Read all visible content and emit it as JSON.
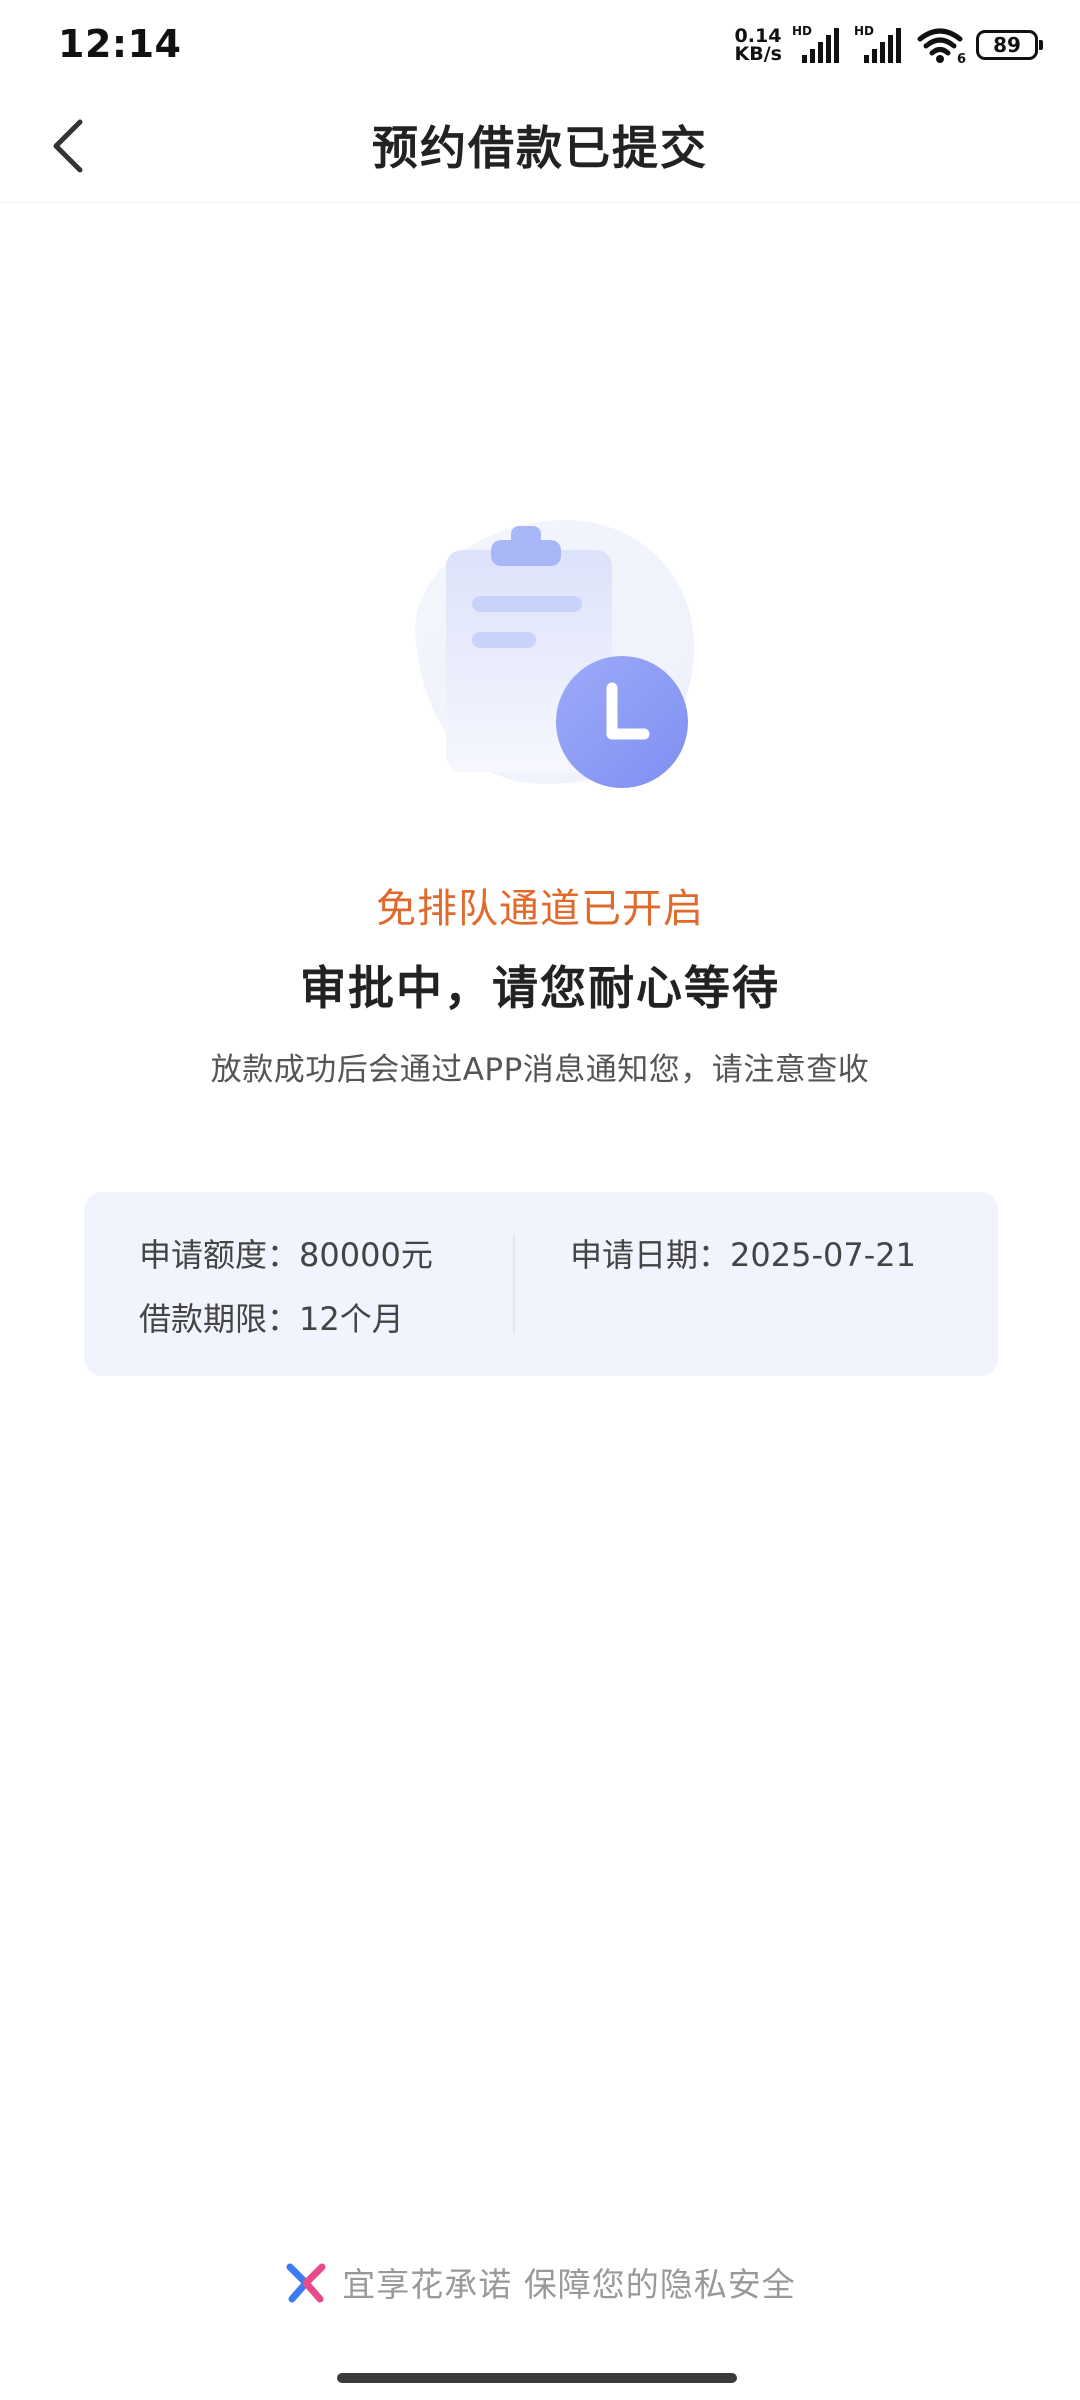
{
  "status_bar": {
    "time": "12:14",
    "net_speed_value": "0.14",
    "net_speed_unit": "KB/s",
    "sim1_label": "HD",
    "sim2_label": "HD",
    "wifi_label": "6",
    "battery_level": "89"
  },
  "header": {
    "title": "预约借款已提交",
    "back_icon": "chevron-left-icon"
  },
  "illustration": {
    "icon": "clipboard-clock-icon",
    "accent_color": "#8B9CF5"
  },
  "status": {
    "sub_text": "免排队通道已开启",
    "main_text": "审批中，请您耐心等待",
    "note": "放款成功后会通过APP消息通知您，请注意查收",
    "sub_color": "#E06A2C"
  },
  "info_card": {
    "amount_label": "申请额度：",
    "amount_value": "80000元",
    "term_label": "借款期限：",
    "term_value": "12个月",
    "date_label": "申请日期：",
    "date_value": "2025-07-21",
    "background": "#F1F4FD"
  },
  "footer": {
    "text": "宜享花承诺 保障您的隐私安全",
    "logo_icon": "yixianghua-logo-icon"
  }
}
